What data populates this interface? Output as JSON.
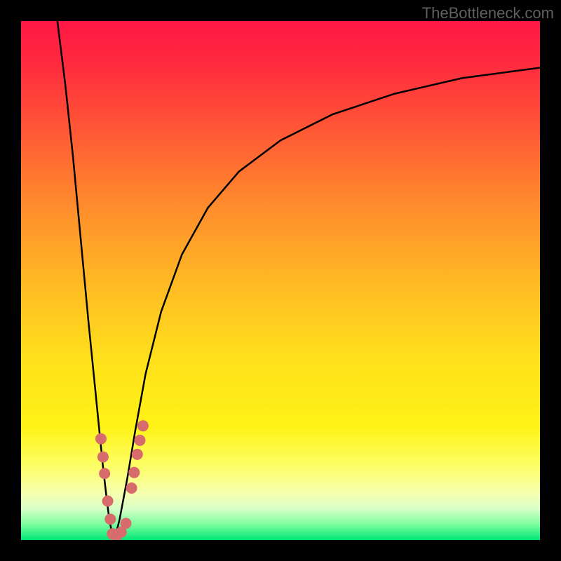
{
  "watermark": "TheBottleneck.com",
  "chart_data": {
    "type": "line",
    "title": "",
    "xlabel": "",
    "ylabel": "",
    "xlim": [
      0,
      100
    ],
    "ylim": [
      0,
      100
    ],
    "gradient_stops": [
      {
        "offset": 0,
        "color": "#ff1744"
      },
      {
        "offset": 0.08,
        "color": "#ff2a3f"
      },
      {
        "offset": 0.2,
        "color": "#ff5436"
      },
      {
        "offset": 0.35,
        "color": "#ff8a2d"
      },
      {
        "offset": 0.5,
        "color": "#ffb824"
      },
      {
        "offset": 0.65,
        "color": "#ffe01c"
      },
      {
        "offset": 0.78,
        "color": "#fff215"
      },
      {
        "offset": 0.86,
        "color": "#fdff6a"
      },
      {
        "offset": 0.91,
        "color": "#f6ffb0"
      },
      {
        "offset": 0.94,
        "color": "#d8ffc8"
      },
      {
        "offset": 0.97,
        "color": "#7cff9e"
      },
      {
        "offset": 1.0,
        "color": "#00e676"
      }
    ],
    "series": [
      {
        "name": "left-curve",
        "x": [
          7.0,
          8.5,
          10.0,
          11.5,
          13.0,
          14.0,
          15.0,
          15.8,
          16.5,
          17.0,
          17.5,
          18.0
        ],
        "y": [
          100,
          88,
          74,
          58,
          42,
          32,
          22,
          14,
          8,
          4,
          1.5,
          0
        ]
      },
      {
        "name": "right-curve",
        "x": [
          18.0,
          19.0,
          20.5,
          22.0,
          24.0,
          27.0,
          31.0,
          36.0,
          42.0,
          50.0,
          60.0,
          72.0,
          85.0,
          100.0
        ],
        "y": [
          0,
          4,
          12,
          21,
          32,
          44,
          55,
          64,
          71,
          77,
          82,
          86,
          89,
          91
        ]
      }
    ],
    "markers": {
      "name": "data-points",
      "color": "#d86b6b",
      "radius": 8,
      "points": [
        {
          "x": 15.4,
          "y": 19.5
        },
        {
          "x": 15.8,
          "y": 16.0
        },
        {
          "x": 16.1,
          "y": 12.8
        },
        {
          "x": 16.7,
          "y": 7.5
        },
        {
          "x": 17.2,
          "y": 4.0
        },
        {
          "x": 17.6,
          "y": 1.2
        },
        {
          "x": 18.3,
          "y": 0.5
        },
        {
          "x": 19.3,
          "y": 1.5
        },
        {
          "x": 20.2,
          "y": 3.2
        },
        {
          "x": 21.3,
          "y": 10.0
        },
        {
          "x": 21.8,
          "y": 13.0
        },
        {
          "x": 22.4,
          "y": 16.5
        },
        {
          "x": 22.9,
          "y": 19.2
        },
        {
          "x": 23.5,
          "y": 22.0
        }
      ]
    }
  }
}
